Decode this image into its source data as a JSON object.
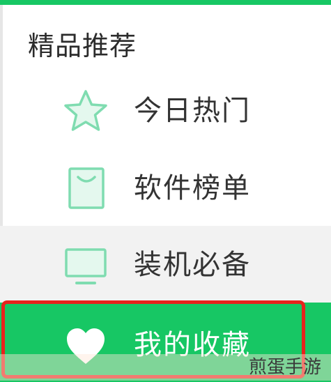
{
  "section": {
    "title": "精品推荐"
  },
  "menu": {
    "items": [
      {
        "label": "今日热门",
        "icon": "star-icon"
      },
      {
        "label": "软件榜单",
        "icon": "bag-icon"
      },
      {
        "label": "装机必备",
        "icon": "monitor-icon"
      },
      {
        "label": "我的收藏",
        "icon": "heart-icon",
        "selected": true
      }
    ]
  },
  "watermark": {
    "text": "煎蛋手游"
  },
  "colors": {
    "accent": "#17c764",
    "icon_outline": "#7fdcb0",
    "icon_fill": "#e4f8ee",
    "hover_background": "#f2f2f2",
    "highlight_outline": "#e8231c",
    "text": "#333333"
  }
}
